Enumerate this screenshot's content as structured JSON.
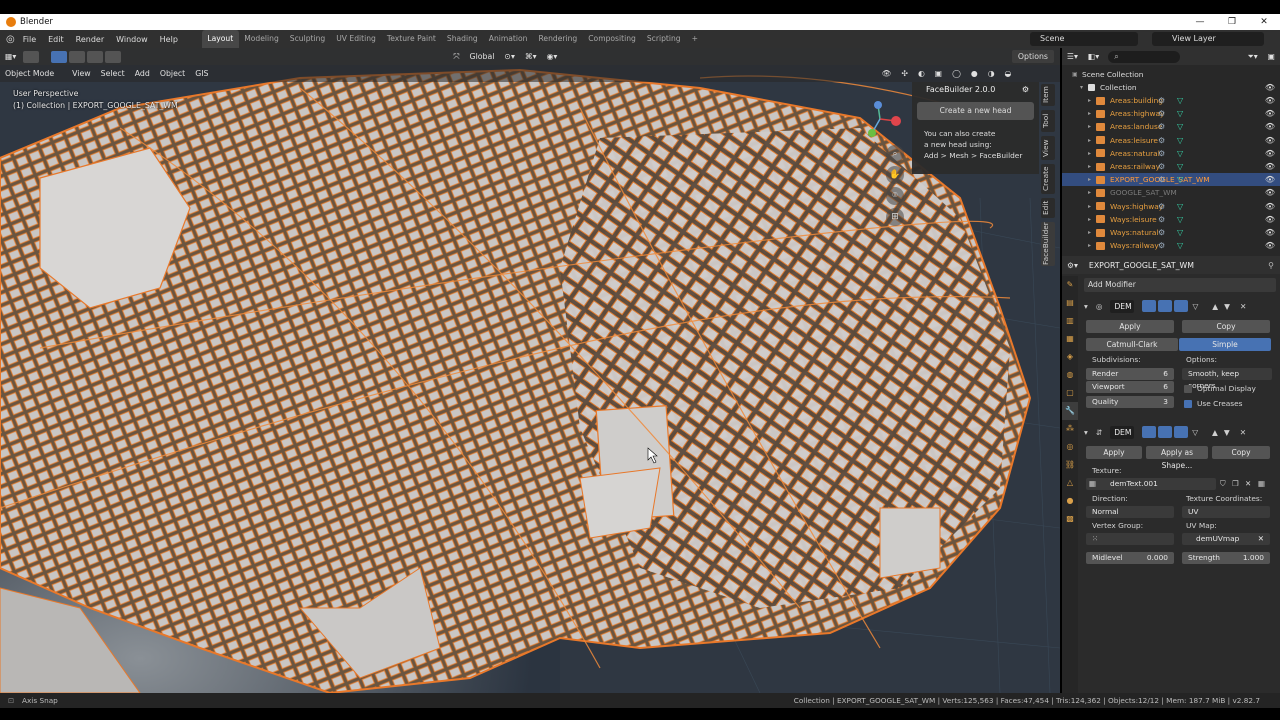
{
  "window": {
    "title": "Blender"
  },
  "menu": [
    "File",
    "Edit",
    "Render",
    "Window",
    "Help"
  ],
  "workspace_tabs": [
    "Layout",
    "Modeling",
    "Sculpting",
    "UV Editing",
    "Texture Paint",
    "Shading",
    "Animation",
    "Rendering",
    "Compositing",
    "Scripting"
  ],
  "active_workspace": "Layout",
  "scene": "Scene",
  "view_layer": "View Layer",
  "viewport": {
    "transform_orientation": "Global",
    "options_label": "Options",
    "mode": "Object Mode",
    "menus": [
      "View",
      "Select",
      "Add",
      "Object",
      "GIS"
    ],
    "perspective": "User Perspective",
    "collection_info": "(1) Collection | EXPORT_GOOGLE_SAT_WM"
  },
  "facebuilder": {
    "title": "FaceBuilder 2.0.0",
    "button": "Create a new head",
    "note_lines": [
      "You can also create",
      "a new head using:",
      "Add > Mesh > FaceBuilder"
    ]
  },
  "sidebar_tabs": [
    "Item",
    "Tool",
    "View",
    "Create",
    "Edit",
    "FaceBuilder"
  ],
  "outliner": {
    "root": "Scene Collection",
    "collection": "Collection",
    "items": [
      {
        "name": "Areas:building"
      },
      {
        "name": "Areas:highway"
      },
      {
        "name": "Areas:landuse"
      },
      {
        "name": "Areas:leisure"
      },
      {
        "name": "Areas:natural"
      },
      {
        "name": "Areas:railway"
      },
      {
        "name": "EXPORT_GOOGLE_SAT_WM",
        "selected": true
      },
      {
        "name": "GOOGLE_SAT_WM",
        "dim": true
      },
      {
        "name": "Ways:highway"
      },
      {
        "name": "Ways:leisure"
      },
      {
        "name": "Ways:natural"
      },
      {
        "name": "Ways:railway"
      }
    ]
  },
  "properties": {
    "object_name": "EXPORT_GOOGLE_SAT_WM",
    "add_modifier": "Add Modifier",
    "mod1": {
      "name": "DEM",
      "apply": "Apply",
      "copy": "Copy",
      "type_a": "Catmull-Clark",
      "type_b": "Simple",
      "subdivisions_label": "Subdivisions:",
      "options_label": "Options:",
      "render_label": "Render",
      "render_value": "6",
      "viewport_label": "Viewport",
      "viewport_value": "6",
      "quality_label": "Quality",
      "quality_value": "3",
      "smooth": "Smooth, keep corners",
      "optimal_display": "Optimal Display",
      "use_creases": "Use Creases"
    },
    "mod2": {
      "name": "DEM",
      "apply": "Apply",
      "apply_shape": "Apply as Shape...",
      "copy": "Copy",
      "texture_label": "Texture:",
      "texture": "demText.001",
      "direction_label": "Direction:",
      "direction": "Normal",
      "texcoords_label": "Texture Coordinates:",
      "texcoords": "UV",
      "vgroup_label": "Vertex Group:",
      "uvmap_label": "UV Map:",
      "uvmap": "demUVmap",
      "midlevel_label": "Midlevel",
      "midlevel_value": "0.000",
      "strength_label": "Strength",
      "strength_value": "1.000"
    }
  },
  "status": {
    "left": "Axis Snap",
    "right": "Collection | EXPORT_GOOGLE_SAT_WM | Verts:125,563 | Faces:47,454 | Tris:124,362 | Objects:12/12 | Mem: 187.7 MiB | v2.82.7"
  },
  "colors": {
    "accent": "#4772b3",
    "selection_orange": "#e8782a",
    "map_grey": "#c8c8c8"
  }
}
